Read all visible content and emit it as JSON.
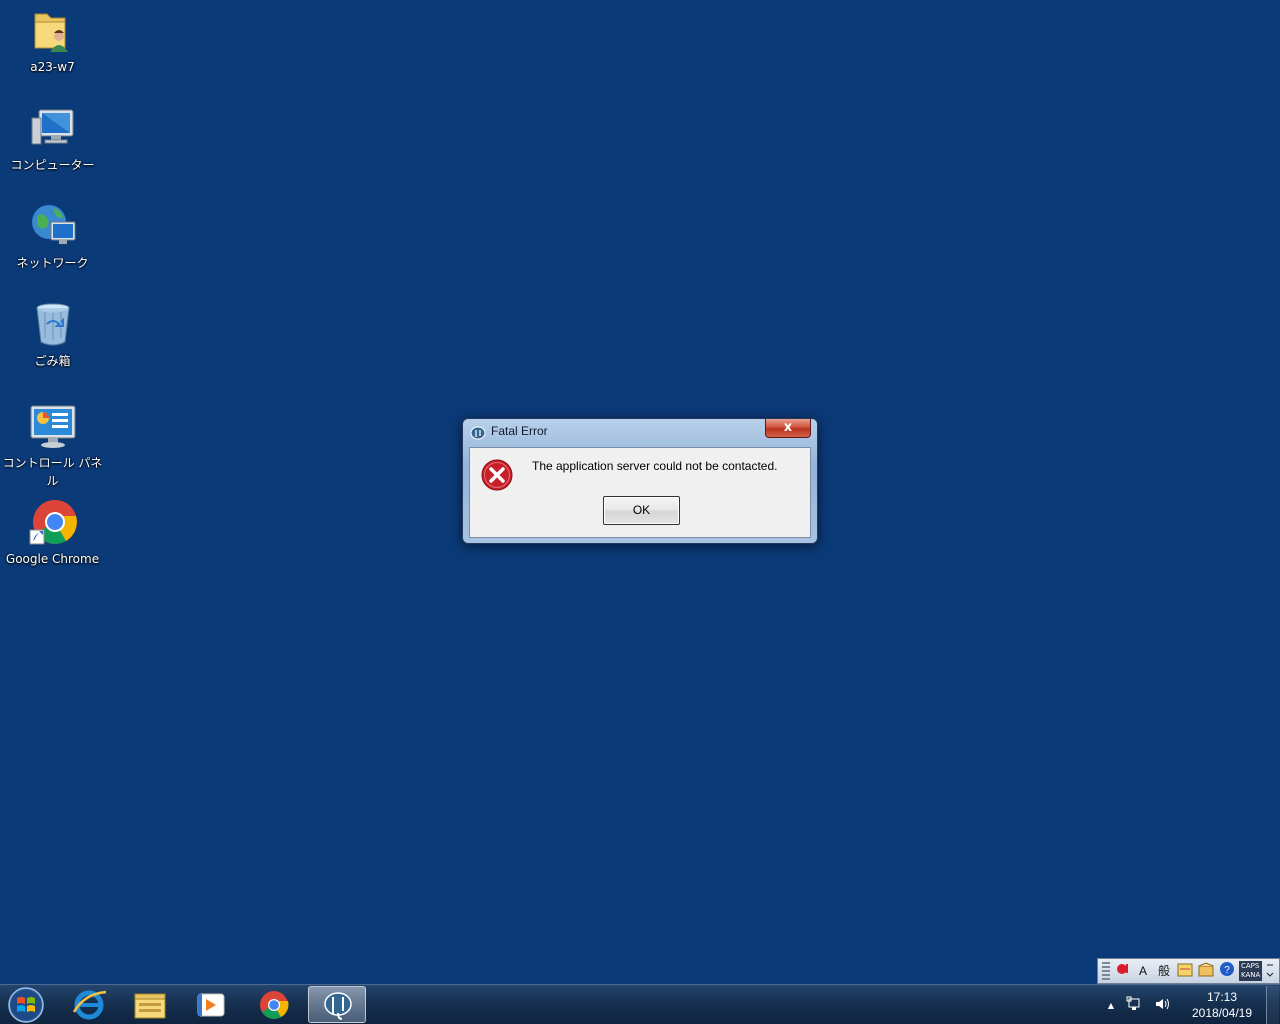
{
  "desktop": {
    "background_color": "#0b3a78",
    "icons": [
      {
        "label": "a23-w7",
        "icon": "user-folder-icon"
      },
      {
        "label": "コンピューター",
        "icon": "computer-icon"
      },
      {
        "label": "ネットワーク",
        "icon": "network-icon"
      },
      {
        "label": "ごみ箱",
        "icon": "recycle-bin-icon"
      },
      {
        "label": "コントロール パネル",
        "icon": "control-panel-icon"
      },
      {
        "label": "Google Chrome",
        "icon": "chrome-icon"
      }
    ]
  },
  "dialog": {
    "title": "Fatal Error",
    "close_label": "x",
    "message": "The application server could not be contacted.",
    "ok_label": "OK"
  },
  "ime_bar": {
    "mode": "A",
    "mode2": "般",
    "caps": "CAPS",
    "kana": "KANA",
    "help": "?"
  },
  "taskbar": {
    "apps": [
      "start-orb-icon",
      "internet-explorer-icon",
      "file-explorer-icon",
      "media-player-icon",
      "chrome-icon",
      "pgadmin-elephant-icon"
    ],
    "tray": {
      "show_hidden": "▲",
      "time": "17:13",
      "date": "2018/04/19"
    }
  }
}
